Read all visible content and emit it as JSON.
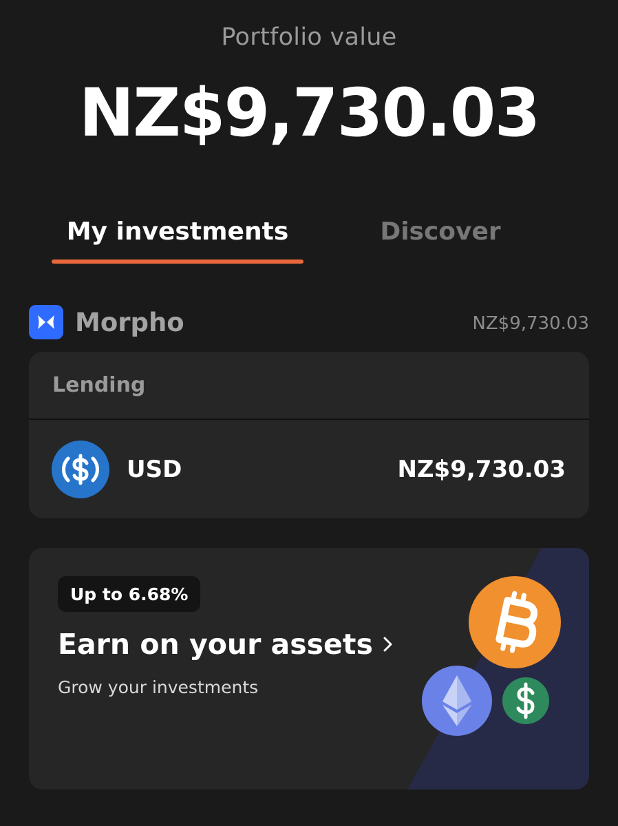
{
  "header": {
    "label": "Portfolio value",
    "value": "NZ$9,730.03"
  },
  "tabs": [
    {
      "label": "My investments",
      "active": true
    },
    {
      "label": "Discover",
      "active": false
    }
  ],
  "colors": {
    "accent": "#e8673b",
    "background": "#1a1a1a",
    "card": "#262626",
    "morpho_blue": "#2f6bff",
    "usdc_blue": "#2775ca",
    "bitcoin_orange": "#f0902f",
    "ethereum_blue": "#6a82e8",
    "dollar_green": "#2e8a5c",
    "promo_panel": "#262a47"
  },
  "provider": {
    "icon": "morpho-butterfly-icon",
    "name": "Morpho",
    "total": "NZ$9,730.03"
  },
  "lending_card": {
    "section_label": "Lending",
    "assets": [
      {
        "icon": "usdc-icon",
        "name": "USD",
        "value": "NZ$9,730.03"
      }
    ]
  },
  "promo": {
    "badge": "Up to 6.68%",
    "title": "Earn on your assets",
    "subtitle": "Grow your investments",
    "icons": [
      "bitcoin-icon",
      "ethereum-icon",
      "dollar-icon"
    ]
  }
}
